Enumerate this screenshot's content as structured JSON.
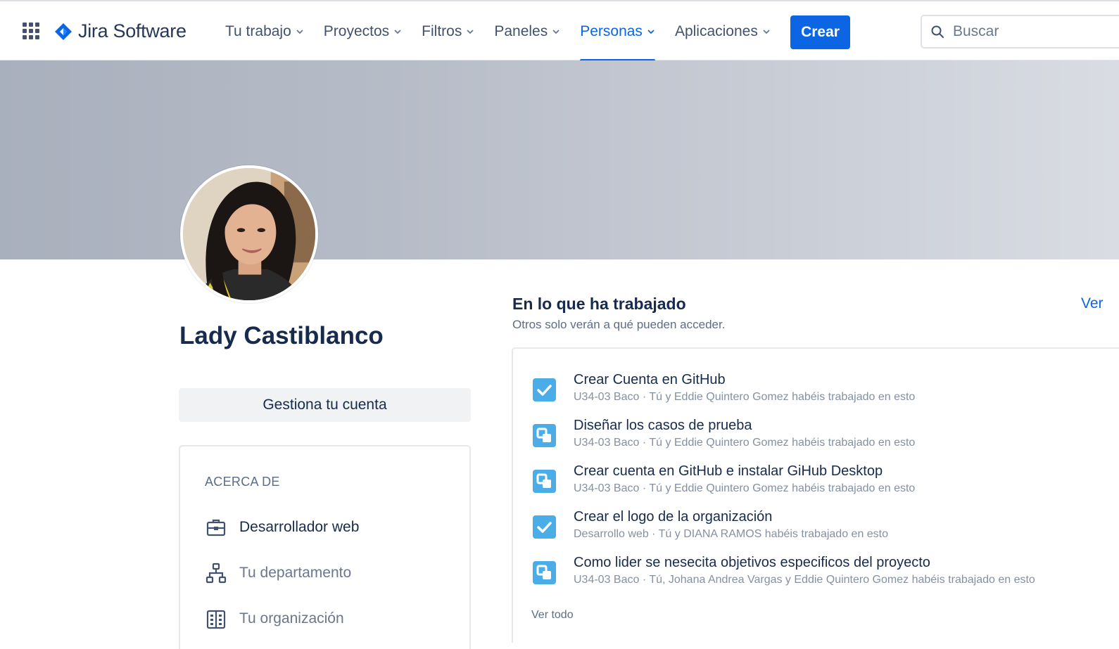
{
  "header": {
    "app_name": "Jira Software",
    "nav": [
      {
        "label": "Tu trabajo",
        "active": false
      },
      {
        "label": "Proyectos",
        "active": false
      },
      {
        "label": "Filtros",
        "active": false
      },
      {
        "label": "Paneles",
        "active": false
      },
      {
        "label": "Personas",
        "active": true
      },
      {
        "label": "Aplicaciones",
        "active": false
      }
    ],
    "create_label": "Crear",
    "search_placeholder": "Buscar"
  },
  "profile": {
    "name": "Lady Castiblanco",
    "manage_account_label": "Gestiona tu cuenta",
    "about": {
      "title": "ACERCA DE",
      "job_title": "Desarrollador web",
      "department": "Tu departamento",
      "organization": "Tu organización"
    }
  },
  "worked_on": {
    "title": "En lo que ha trabajado",
    "subtitle": "Otros solo verán a qué pueden acceder.",
    "view_all_top": "Ver",
    "view_all_bottom": "Ver todo",
    "items": [
      {
        "title": "Crear Cuenta en GitHub",
        "meta": "U34-03 Baco · Tú y Eddie Quintero Gomez habéis trabajado en esto",
        "icon": "task-icon"
      },
      {
        "title": "Diseñar los casos de prueba",
        "meta": "U34-03 Baco · Tú y Eddie Quintero Gomez habéis trabajado en esto",
        "icon": "subtask-icon"
      },
      {
        "title": "Crear cuenta en GitHub e instalar GiHub Desktop",
        "meta": "U34-03 Baco · Tú y Eddie Quintero Gomez habéis trabajado en esto",
        "icon": "subtask-icon"
      },
      {
        "title": "Crear el logo de la organización",
        "meta": "Desarrollo web · Tú y DIANA RAMOS habéis trabajado en esto",
        "icon": "task-icon"
      },
      {
        "title": "Como lider se nesecita objetivos especificos del proyecto",
        "meta": "U34-03 Baco · Tú, Johana Andrea Vargas y Eddie Quintero Gomez habéis trabajado en esto",
        "icon": "subtask-icon"
      }
    ]
  },
  "colors": {
    "brand_blue": "#0c66e4",
    "issue_icon_blue": "#4bade8",
    "text_primary": "#172b4d",
    "text_subtle": "#8590a2"
  }
}
